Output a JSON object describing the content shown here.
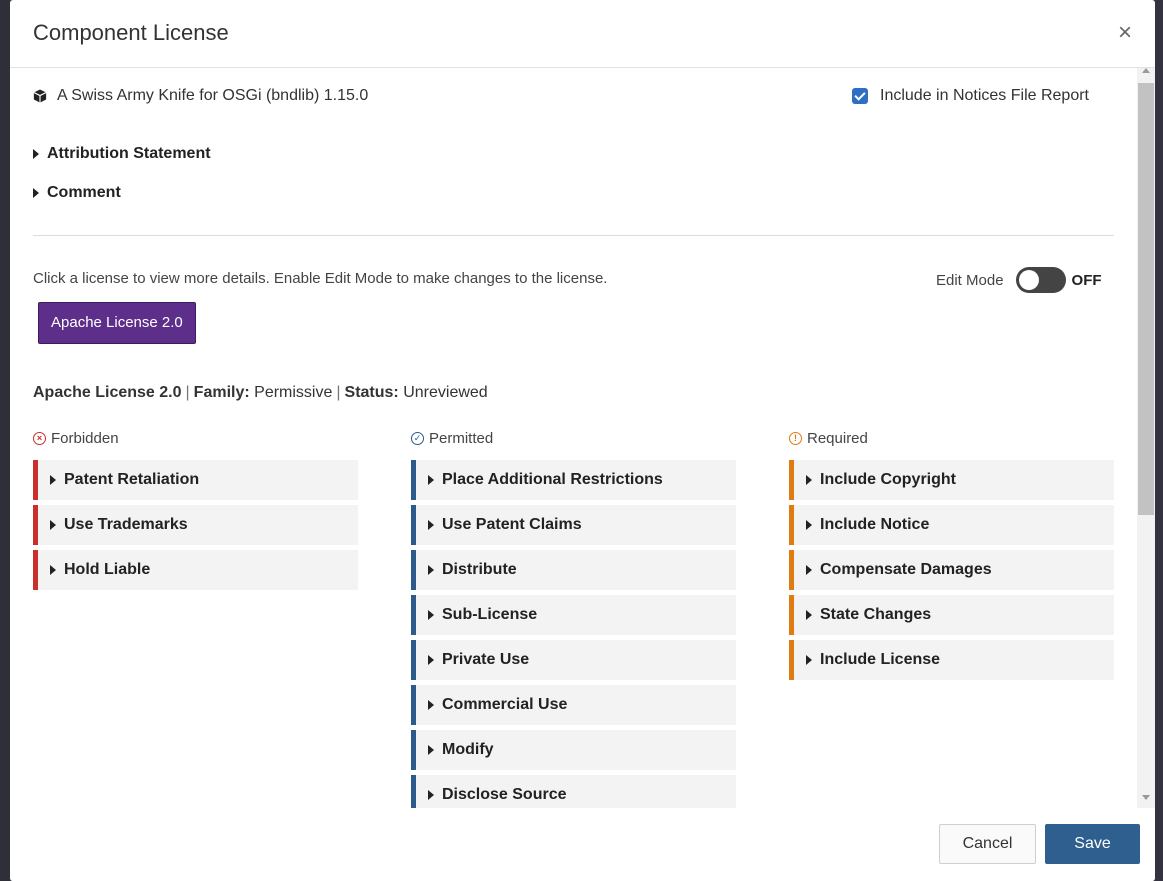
{
  "modal": {
    "title": "Component License",
    "close_glyph": "×"
  },
  "component": {
    "name": "A Swiss Army Knife for OSGi (bndlib) 1.15.0",
    "icon": "cube-icon"
  },
  "notices": {
    "label": "Include in Notices File Report",
    "checked": true
  },
  "sections": {
    "attribution": "Attribution Statement",
    "comment": "Comment"
  },
  "hint": "Click a license to view more details. Enable Edit Mode to make changes to the license.",
  "edit_mode": {
    "label": "Edit Mode",
    "state": "OFF"
  },
  "license_button": "Apache License 2.0",
  "license_info": {
    "name": "Apache License 2.0",
    "family_label": "Family:",
    "family": "Permissive",
    "status_label": "Status:",
    "status": "Unreviewed",
    "separator": "|"
  },
  "columns": {
    "forbidden": {
      "title": "Forbidden",
      "icon": "x-circle-icon",
      "glyph": "×",
      "color": "#c9302c",
      "items": [
        "Patent Retaliation",
        "Use Trademarks",
        "Hold Liable"
      ]
    },
    "permitted": {
      "title": "Permitted",
      "icon": "check-circle-icon",
      "glyph": "✓",
      "color": "#2d5a8c",
      "items": [
        "Place Additional Restrictions",
        "Use Patent Claims",
        "Distribute",
        "Sub-License",
        "Private Use",
        "Commercial Use",
        "Modify",
        "Disclose Source"
      ]
    },
    "required": {
      "title": "Required",
      "icon": "exclamation-circle-icon",
      "glyph": "!",
      "color": "#e07b12",
      "items": [
        "Include Copyright",
        "Include Notice",
        "Compensate Damages",
        "State Changes",
        "Include License"
      ]
    }
  },
  "footer": {
    "cancel": "Cancel",
    "save": "Save"
  },
  "colors": {
    "license_button": "#5e2f8a",
    "save_button": "#2f5f8e",
    "checkbox": "#2e6ec3"
  }
}
